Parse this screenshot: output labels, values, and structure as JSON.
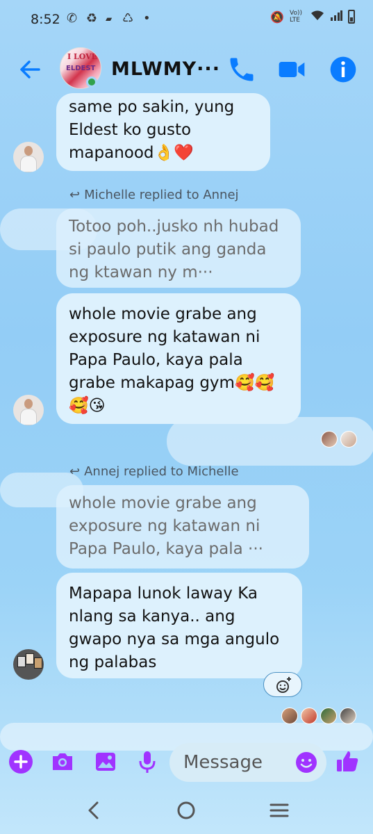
{
  "status_bar": {
    "time": "8:52",
    "network": "Vo)) LTE"
  },
  "header": {
    "title": "MLWMY···",
    "avatar_text_1": "I LOVE",
    "avatar_text_2": "ELDEST"
  },
  "messages": [
    {
      "type": "incoming",
      "text": "same po sakin, yung Eldest ko gusto mapanood👌❤️"
    },
    {
      "type": "reply_label",
      "text": "Michelle replied to Annej"
    },
    {
      "type": "quoted",
      "text": "Totoo poh..jusko nh hubad si paulo putik ang ganda ng ktawan ny m···"
    },
    {
      "type": "incoming",
      "text": "whole movie grabe ang exposure ng katawan ni Papa Paulo, kaya pala grabe makapag gym🥰🥰🥰😘"
    },
    {
      "type": "reply_label",
      "text": "Annej replied to Michelle"
    },
    {
      "type": "quoted",
      "text": "whole movie grabe ang exposure ng katawan ni Papa Paulo, kaya pala ···"
    },
    {
      "type": "incoming",
      "text": "Mapapa lunok laway Ka nlang sa kanya.. ang gwapo nya sa mga angulo ng palabas"
    }
  ],
  "composer": {
    "placeholder": "Message"
  },
  "colors": {
    "accent": "#0a7cff",
    "composer_purple": "#a033ff",
    "bubble": "#ddf1fd"
  },
  "icons": [
    "back-arrow-icon",
    "phone-icon",
    "video-icon",
    "info-icon",
    "plus-icon",
    "camera-icon",
    "image-icon",
    "mic-icon",
    "emoji-icon",
    "thumbs-up-icon"
  ]
}
